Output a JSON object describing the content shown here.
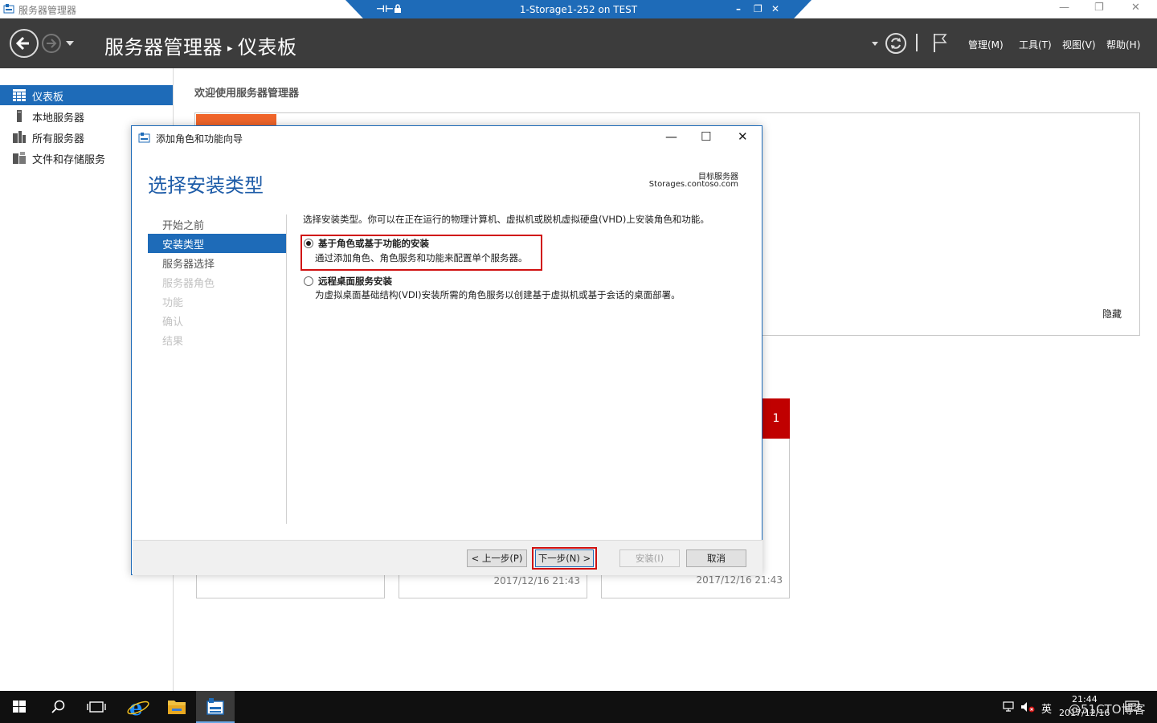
{
  "window": {
    "title": "服务器管理器",
    "minimize": "—",
    "restore": "❐",
    "close": "✕"
  },
  "rdp": {
    "title": "1-Storage1-252 on TEST",
    "minimize": "–",
    "restore": "❐",
    "close": "✕"
  },
  "header": {
    "app": "服务器管理器",
    "separator": "▸",
    "page": "仪表板",
    "menus": [
      "管理(M)",
      "工具(T)",
      "视图(V)",
      "帮助(H)"
    ]
  },
  "sidebar": {
    "items": [
      {
        "label": "仪表板",
        "active": true
      },
      {
        "label": "本地服务器",
        "active": false
      },
      {
        "label": "所有服务器",
        "active": false
      },
      {
        "label": "文件和存储服务",
        "active": false
      }
    ]
  },
  "content": {
    "welcome": "欢迎使用服务器管理器",
    "hide": "隐藏",
    "badge_count": "1",
    "tiles": [
      {
        "time": ""
      },
      {
        "time": "2017/12/16 21:43"
      },
      {
        "time": "2017/12/16 21:43"
      }
    ]
  },
  "dialog": {
    "title": "添加角色和功能向导",
    "minimize": "—",
    "maximize": "☐",
    "close": "✕",
    "heading": "选择安装类型",
    "target_label": "目标服务器",
    "target_value": "Storages.contoso.com",
    "steps": [
      {
        "label": "开始之前",
        "state": "normal"
      },
      {
        "label": "安装类型",
        "state": "active"
      },
      {
        "label": "服务器选择",
        "state": "normal"
      },
      {
        "label": "服务器角色",
        "state": "disabled"
      },
      {
        "label": "功能",
        "state": "disabled"
      },
      {
        "label": "确认",
        "state": "disabled"
      },
      {
        "label": "结果",
        "state": "disabled"
      }
    ],
    "description": "选择安装类型。你可以在正在运行的物理计算机、虚拟机或脱机虚拟硬盘(VHD)上安装角色和功能。",
    "options": [
      {
        "title": "基于角色或基于功能的安装",
        "desc": "通过添加角色、角色服务和功能来配置单个服务器。",
        "checked": true
      },
      {
        "title": "远程桌面服务安装",
        "desc": "为虚拟桌面基础结构(VDI)安装所需的角色服务以创建基于虚拟机或基于会话的桌面部署。",
        "checked": false
      }
    ],
    "buttons": {
      "prev": "< 上一步(P)",
      "next": "下一步(N) >",
      "install": "安装(I)",
      "cancel": "取消"
    }
  },
  "taskbar": {
    "ime": "英",
    "time": "21:44",
    "date": "2017/12/16",
    "watermark": "@51CTO博客"
  },
  "colors": {
    "accent": "#1e6bb8",
    "header_bg": "#3c3c3c",
    "highlight_red": "#d01010",
    "orange": "#f0652a",
    "badge_red": "#c00000"
  }
}
